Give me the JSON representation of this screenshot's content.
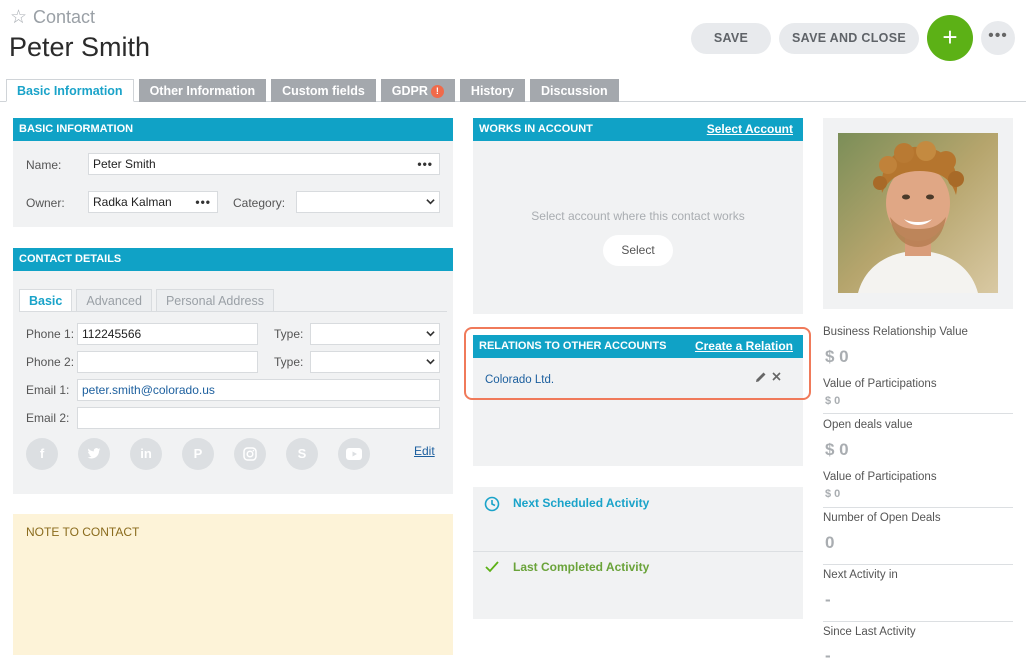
{
  "header": {
    "entity": "Contact",
    "title": "Peter Smith",
    "save_label": "SAVE",
    "save_close_label": "SAVE AND CLOSE",
    "add_label": "+",
    "more_label": "•••"
  },
  "tabs": [
    {
      "label": "Basic Information"
    },
    {
      "label": "Other Information"
    },
    {
      "label": "Custom fields"
    },
    {
      "label": "GDPR",
      "badge": "!"
    },
    {
      "label": "History"
    },
    {
      "label": "Discussion"
    }
  ],
  "basic_info": {
    "heading": "BASIC INFORMATION",
    "name_label": "Name:",
    "name_value": "Peter Smith",
    "owner_label": "Owner:",
    "owner_value": "Radka Kalman",
    "category_label": "Category:",
    "category_value": ""
  },
  "contact_details": {
    "heading": "CONTACT DETAILS",
    "sub_tabs": [
      "Basic",
      "Advanced",
      "Personal Address"
    ],
    "phone1_label": "Phone 1:",
    "phone1_value": "112245566",
    "phone2_label": "Phone 2:",
    "phone2_value": "",
    "type_label": "Type:",
    "email1_label": "Email 1:",
    "email1_value": "peter.smith@colorado.us",
    "email2_label": "Email 2:",
    "email2_value": "",
    "edit_label": "Edit",
    "social": [
      "facebook-icon",
      "twitter-icon",
      "linkedin-icon",
      "pinterest-icon",
      "instagram-icon",
      "skype-icon",
      "youtube-icon"
    ]
  },
  "note": {
    "title": "NOTE TO CONTACT"
  },
  "works_in_account": {
    "heading": "WORKS IN ACCOUNT",
    "link": "Select Account",
    "hint": "Select account where this contact works",
    "select_label": "Select"
  },
  "relations": {
    "heading": "RELATIONS TO OTHER ACCOUNTS",
    "link": "Create a Relation",
    "item": "Colorado Ltd."
  },
  "activities": {
    "next": "Next Scheduled Activity",
    "last": "Last Completed Activity"
  },
  "stats": {
    "brv_label": "Business Relationship Value",
    "brv_value": "$ 0",
    "vop1_label": "Value of Participations",
    "vop1_value": "$ 0",
    "open_deals_label": "Open deals value",
    "open_deals_value": "$ 0",
    "vop2_label": "Value of Participations",
    "vop2_value": "$ 0",
    "num_open_label": "Number of Open Deals",
    "num_open_value": "0",
    "next_act_label": "Next Activity in",
    "next_act_value": "-",
    "since_last_label": "Since Last Activity",
    "since_last_value": "-"
  },
  "colors": {
    "accent": "#10a2c6",
    "add_button": "#5cb116",
    "highlight": "#f07a5a",
    "note_bg": "#fdf3d8"
  }
}
